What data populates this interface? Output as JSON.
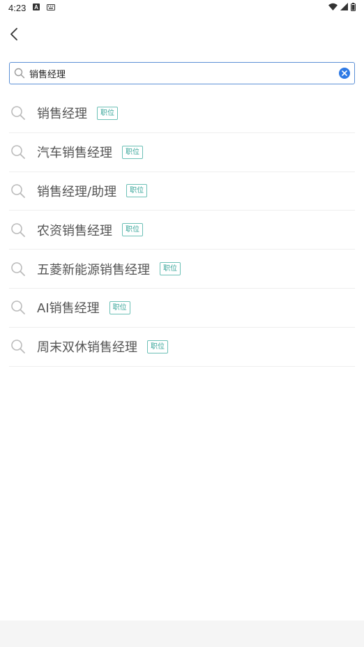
{
  "status_bar": {
    "time": "4:23",
    "icons": [
      "a-icon",
      "keyboard-icon",
      "wifi-icon",
      "signal-icon",
      "battery-icon"
    ]
  },
  "search": {
    "value": "销售经理",
    "placeholder": ""
  },
  "suggestions": [
    {
      "text": "销售经理",
      "tag": "职位"
    },
    {
      "text": "汽车销售经理",
      "tag": "职位"
    },
    {
      "text": "销售经理/助理",
      "tag": "职位"
    },
    {
      "text": "农资销售经理",
      "tag": "职位"
    },
    {
      "text": "五菱新能源销售经理",
      "tag": "职位"
    },
    {
      "text": "AI销售经理",
      "tag": "职位"
    },
    {
      "text": "周末双休销售经理",
      "tag": "职位"
    }
  ],
  "colors": {
    "accent": "#2f7ae5",
    "tag_text": "#3aa69a",
    "tag_border": "#6cc0b6",
    "search_border": "#5b8fd6"
  }
}
